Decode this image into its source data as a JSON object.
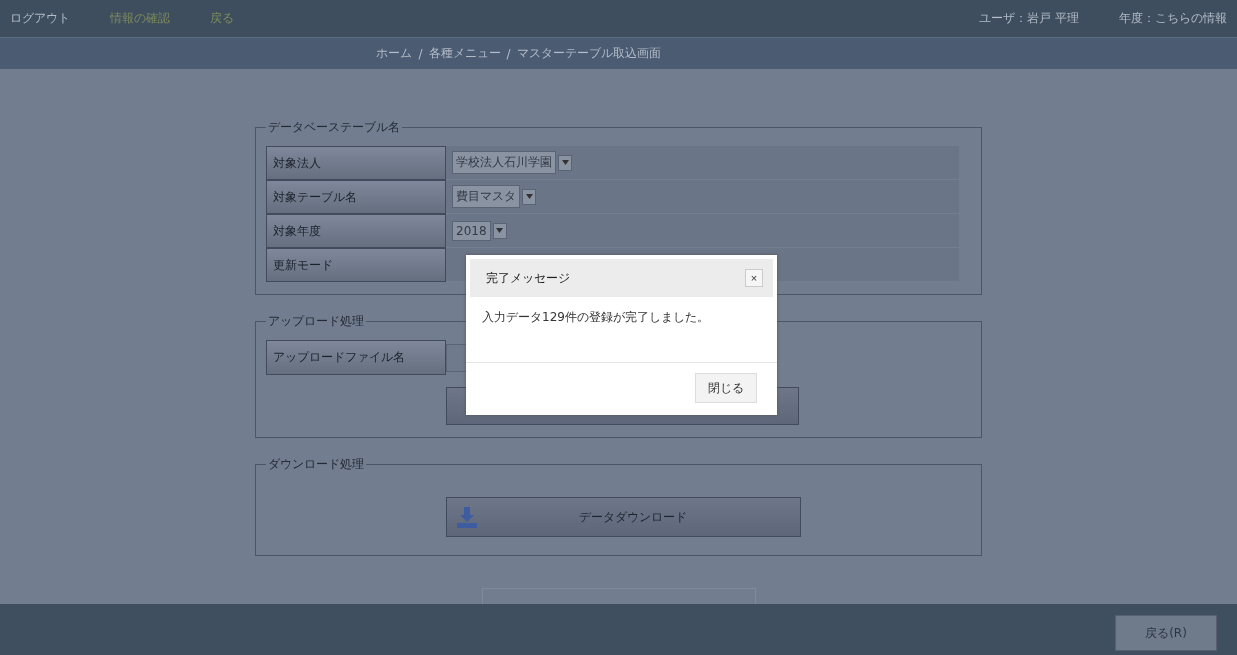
{
  "header": {
    "left_links": [
      "ログアウト",
      "情報の確認",
      "戻る"
    ],
    "user": "ユーザ：岩戸 平理",
    "year_info": "年度：こちらの情報"
  },
  "breadcrumb": [
    "ホーム",
    "/",
    "各種メニュー",
    "/",
    "マスターテーブル取込画面"
  ],
  "db_section": {
    "legend": "データベーステーブル名",
    "rows": [
      {
        "label": "対象法人",
        "kind": "select",
        "value": "学校法人石川学園"
      },
      {
        "label": "対象テーブル名",
        "kind": "select",
        "value": "費目マスタ"
      },
      {
        "label": "対象年度",
        "kind": "select",
        "value": "2018"
      },
      {
        "label": "更新モード",
        "kind": "blank"
      }
    ]
  },
  "upload_section": {
    "legend": "アップロード処理",
    "file_label": "アップロードファイル名"
  },
  "download_section": {
    "legend": "ダウンロード処理",
    "button": "データダウンロード"
  },
  "dialog": {
    "title": "完了メッセージ",
    "close": "×",
    "message": "入力データ129件の登録が完了しました。",
    "button": "閉じる"
  },
  "footer": {
    "button": "戻る(R)"
  }
}
